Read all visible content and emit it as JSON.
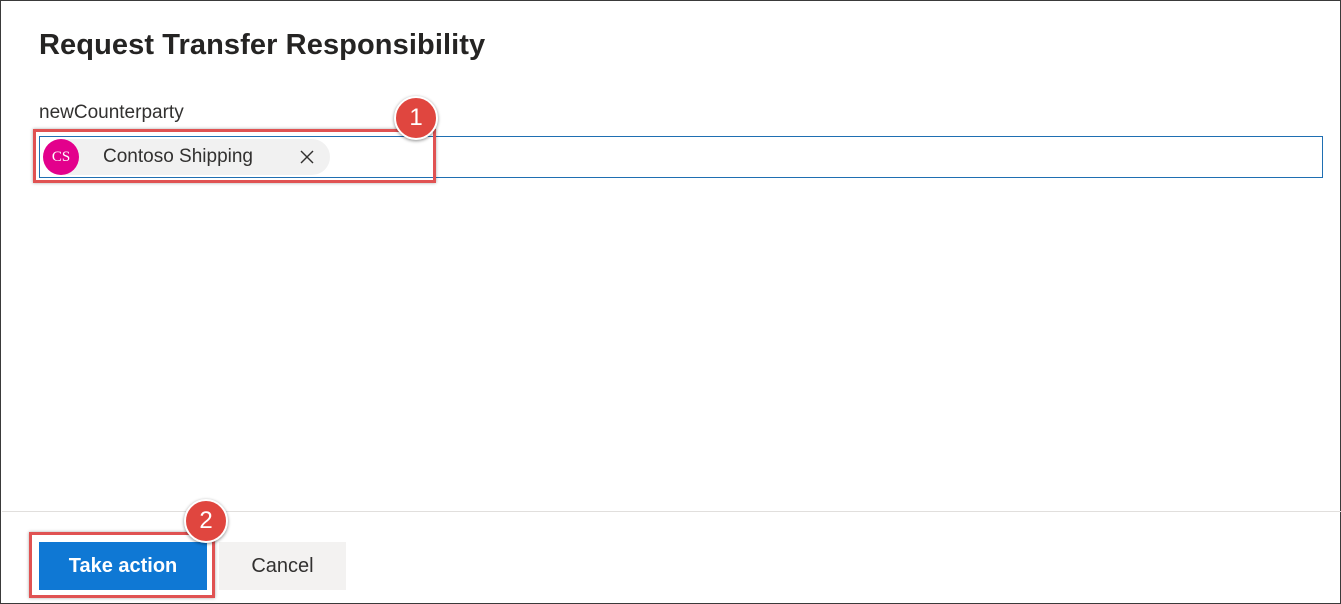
{
  "dialog": {
    "title": "Request Transfer Responsibility"
  },
  "field": {
    "label": "newCounterparty",
    "selected": {
      "initials": "CS",
      "name": "Contoso Shipping",
      "avatar_color": "#e3008c"
    },
    "remove_icon": "close-icon"
  },
  "footer": {
    "primary_label": "Take action",
    "secondary_label": "Cancel"
  },
  "annotations": {
    "step1": "1",
    "step2": "2",
    "color": "#e0463f"
  }
}
